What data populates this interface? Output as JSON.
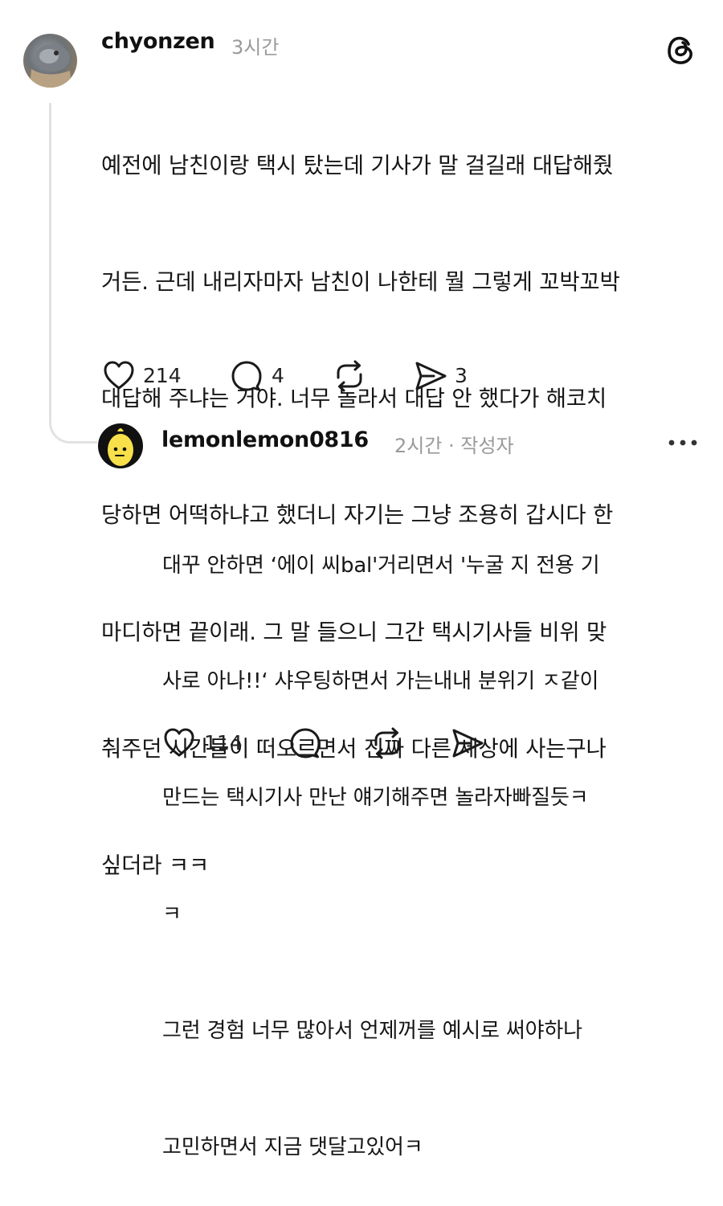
{
  "app": {
    "name": "Threads"
  },
  "post": {
    "username": "chyonzen",
    "time": "3시간",
    "lines": [
      "예전에 남친이랑 택시 탔는데 기사가 말 걸길래 대답해줬",
      "거든. 근데 내리자마자 남친이 나한테 뭘 그렇게 꼬박꼬박",
      "대답해 주냐는 거야. 너무 놀라서 대답 안 했다가 해코치",
      "당하면 어떡하냐고 했더니 자기는 그냥 조용히 갑시다 한",
      "마디하면 끝이래. 그 말 들으니 그간 택시기사들 비위 맞",
      "춰주던 시간들이 떠오르면서 진짜 다른 세상에 사는구나",
      "싶더라 ㅋㅋ"
    ],
    "likes": "214",
    "replies": "4",
    "shares": "3",
    "icons": [
      "heart-icon",
      "comment-icon",
      "repost-icon",
      "share-icon"
    ]
  },
  "reply": {
    "username": "lemonlemon0816",
    "time": "2시간",
    "separator": "·",
    "author_badge": "작성자",
    "more_icon": "more-dots-icon",
    "lines": [
      "대꾸 안하면 ‘에이 씨bal'거리면서 '누굴 지 전용 기",
      "사로 아나!!‘ 샤우팅하면서 가는내내 분위기 ㅈ같이",
      "만드는 택시기사 만난 얘기해주면 놀라자빠질듯ㅋ",
      "ㅋ",
      "그런 경험 너무 많아서 언제꺼를 예시로 써야하나",
      "고민하면서 지금 댓달고있어ㅋ"
    ],
    "likes": "114"
  },
  "colors": {
    "text": "#151515",
    "meta": "#9a9a9a",
    "thread_line": "#e2e2e2",
    "lemon": "#f7e04a"
  }
}
